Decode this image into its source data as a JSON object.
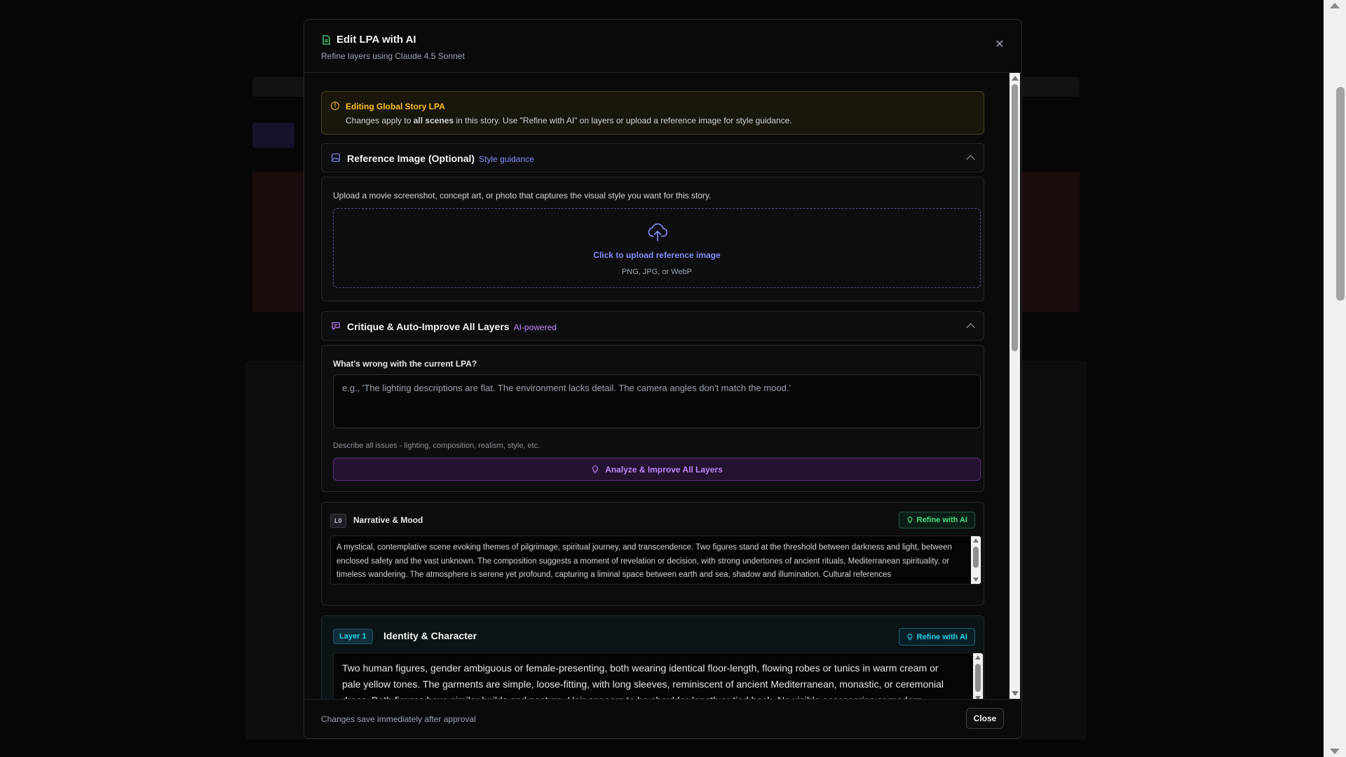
{
  "modal": {
    "title": "Edit LPA with AI",
    "subtitle": "Refine layers using Claude 4.5 Sonnet",
    "close_icon": "close-icon"
  },
  "notice": {
    "title": "Editing Global Story LPA",
    "text_before": "Changes apply to ",
    "text_bold": "all scenes",
    "text_after": " in this story. Use \"Refine with AI\" on layers or upload a reference image for style guidance."
  },
  "reference": {
    "title": "Reference Image (Optional)",
    "tag": "Style guidance",
    "description": "Upload a movie screenshot, concept art, or photo that captures the visual style you want for this story.",
    "upload_cta": "Click to upload reference image",
    "formats": "PNG, JPG, or WebP"
  },
  "critique": {
    "title": "Critique & Auto-Improve All Layers",
    "tag": "AI-powered",
    "question": "What's wrong with the current LPA?",
    "placeholder": "e.g., 'The lighting descriptions are flat. The environment lacks detail. The camera angles don't match the mood.'",
    "value": "",
    "hint": "Describe all issues - lighting, composition, realism, style, etc.",
    "button_label": "Analyze & Improve All Layers"
  },
  "layers": [
    {
      "badge": "L0",
      "name": "Narrative & Mood",
      "refine_label": "Refine with AI",
      "text": "A mystical, contemplative scene evoking themes of pilgrimage, spiritual journey, and transcendence. Two figures stand at the threshold between darkness and light, between enclosed safety and the vast unknown. The composition suggests a moment of revelation or decision, with strong undertones of ancient rituals, Mediterranean spirituality, or timeless wandering. The atmosphere is serene yet profound, capturing a liminal space between earth and sea, shadow and illumination. Cultural references"
    },
    {
      "badge": "Layer 1",
      "name": "Identity & Character",
      "refine_label": "Refine with AI",
      "text": "Two human figures, gender ambiguous or female-presenting, both wearing identical floor-length, flowing robes or tunics in warm cream or pale yellow tones. The garments are simple, loose-fitting, with long sleeves, reminiscent of ancient Mediterranean, monastic, or ceremonial dress. Both figures have similar builds and posture. Hair appears to be shoulder-length or tied back. No visible accessories or modern elements."
    }
  ],
  "footer": {
    "note": "Changes save immediately after approval",
    "close_label": "Close"
  },
  "colors": {
    "notice_accent": "#fbbf24",
    "reference_accent": "#818cf8",
    "critique_accent": "#c084fc",
    "layer0_accent": "#4ade80",
    "layer1_accent": "#22d3ee"
  }
}
